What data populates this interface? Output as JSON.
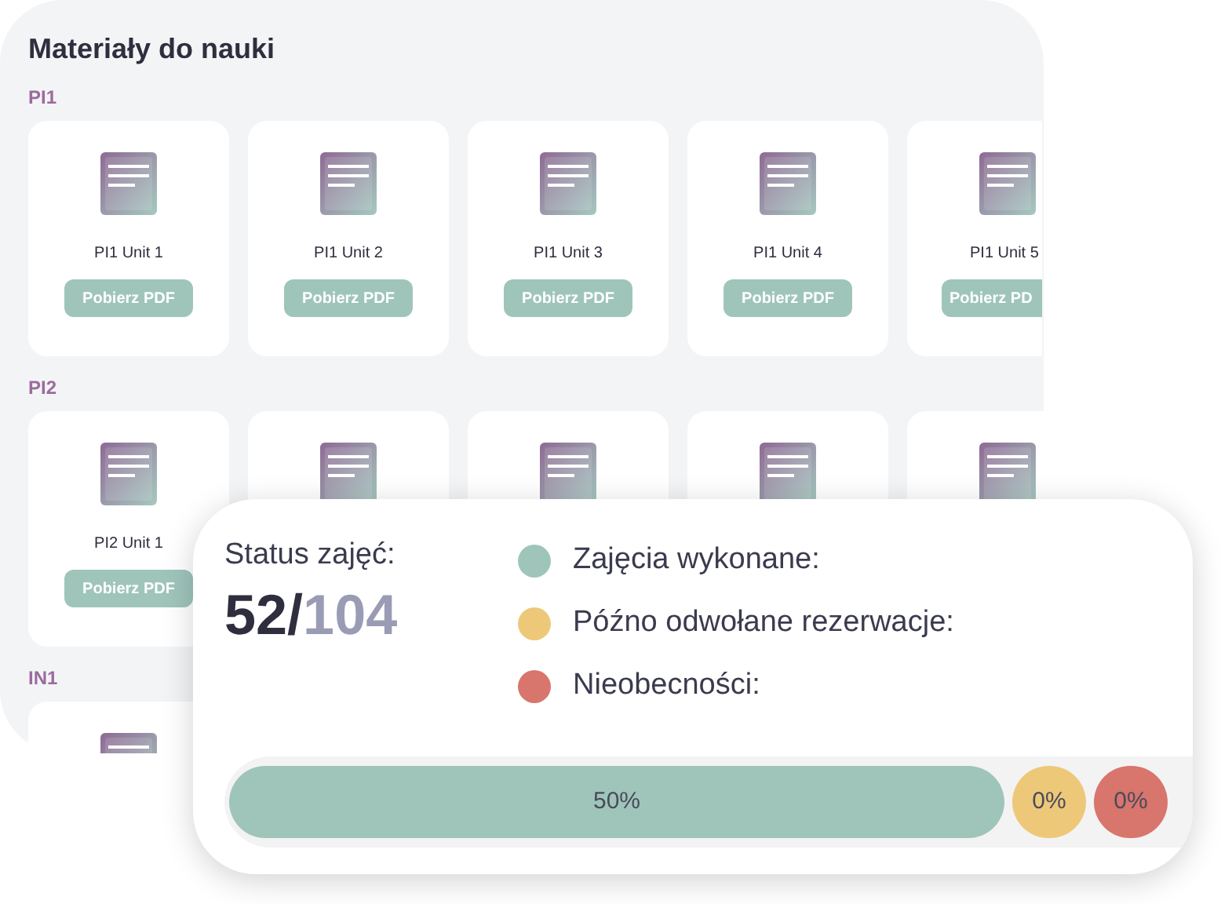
{
  "materials": {
    "title": "Materiały do nauki",
    "sections": [
      {
        "label": "PI1",
        "cards": [
          {
            "kind": "document",
            "title": "PI1 Unit 1",
            "button": "Pobierz PDF"
          },
          {
            "kind": "document",
            "title": "PI1 Unit 2",
            "button": "Pobierz PDF"
          },
          {
            "kind": "document",
            "title": "PI1 Unit 3",
            "button": "Pobierz PDF"
          },
          {
            "kind": "document",
            "title": "PI1 Unit 4",
            "button": "Pobierz PDF"
          },
          {
            "kind": "cut",
            "title": "PI1 Unit 5",
            "button": "Pobierz PD"
          }
        ]
      },
      {
        "label": "PI2",
        "cards": [
          {
            "kind": "document",
            "title": "PI2 Unit 1",
            "button": "Pobierz PDF"
          },
          {
            "kind": "covered"
          },
          {
            "kind": "covered"
          },
          {
            "kind": "covered"
          },
          {
            "kind": "covered"
          }
        ]
      },
      {
        "label": "IN1",
        "cards": [
          {
            "kind": "covered"
          }
        ]
      }
    ]
  },
  "status": {
    "title": "Status zajęć:",
    "done": "52/",
    "total": "104",
    "legend": [
      {
        "label": "Zajęcia wykonane:",
        "color": "#9fc5bb"
      },
      {
        "label": "Późno odwołane rezerwacje:",
        "color": "#eec879"
      },
      {
        "label": "Nieobecności:",
        "color": "#d8756c"
      }
    ],
    "segments": [
      {
        "label": "50%",
        "color": "#9fc5bb",
        "kind": "wide"
      },
      {
        "label": "0%",
        "color": "#eec879",
        "kind": "small"
      },
      {
        "label": "0%",
        "color": "#d8756c",
        "kind": "small"
      }
    ]
  }
}
